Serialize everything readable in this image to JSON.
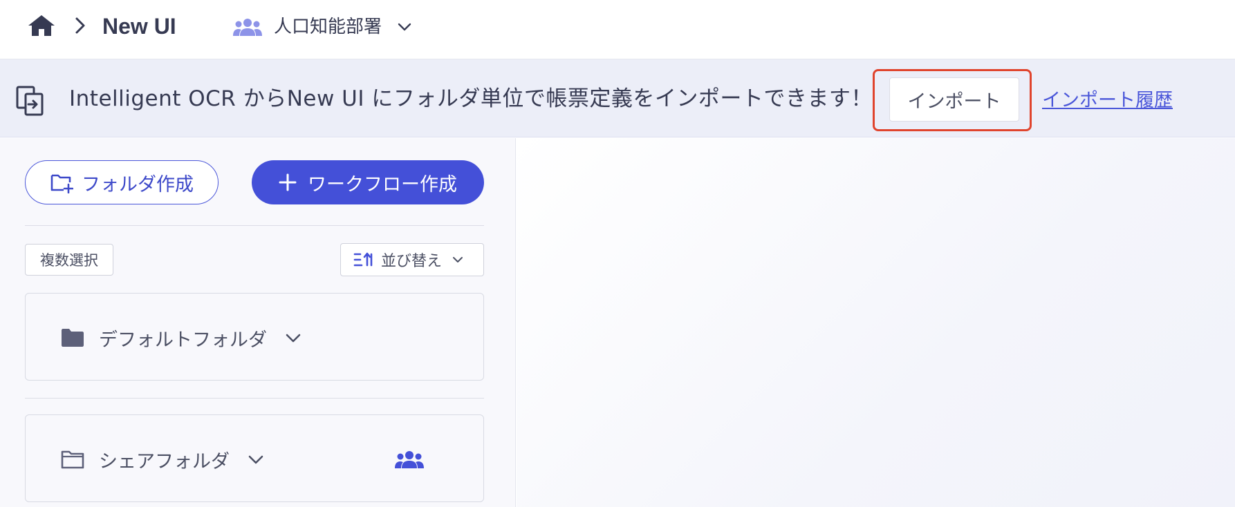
{
  "header": {
    "home_icon": "home-icon",
    "title": "New UI",
    "department": {
      "icon": "users-icon",
      "label": "人口知能部署"
    }
  },
  "banner": {
    "icon": "import-icon",
    "message": "Intelligent OCR からNew UI にフォルダ単位で帳票定義をインポートできます！",
    "import_button_label": "インポート",
    "import_history_link": "インポート履歴",
    "highlight_color": "#e0442d"
  },
  "sidebar": {
    "create_folder_label": "フォルダ作成",
    "create_workflow_label": "ワークフロー作成",
    "multi_select_label": "複数選択",
    "sort_label": "並び替え",
    "folders": [
      {
        "label": "デフォルトフォルダ",
        "icon": "folder-filled-icon",
        "shared": false
      },
      {
        "label": "シェアフォルダ",
        "icon": "folder-outline-icon",
        "shared": true
      }
    ]
  },
  "colors": {
    "accent": "#4450d8",
    "banner_bg": "#eceef8",
    "text": "#363a52",
    "link": "#4a56d9"
  }
}
